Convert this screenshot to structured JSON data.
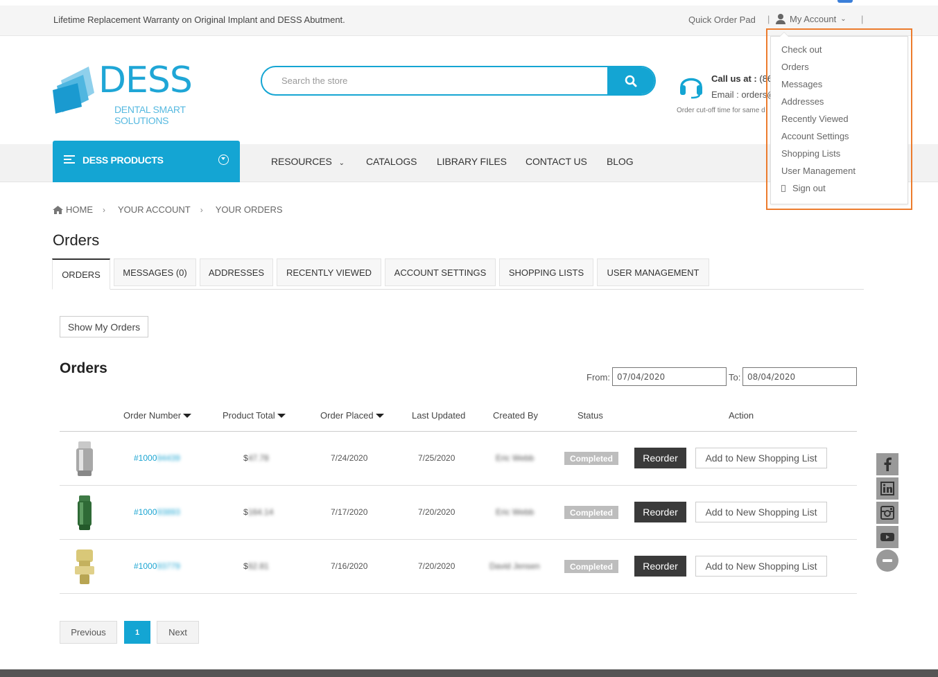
{
  "topbar": {
    "warranty": "Lifetime Replacement Warranty on Original Implant and DESS Abutment.",
    "quick_order": "Quick Order Pad",
    "sep": "|",
    "my_account": "My Account"
  },
  "logo": {
    "name": "DESS",
    "tagline": "DENTAL SMART SOLUTIONS"
  },
  "search": {
    "placeholder": "Search the store"
  },
  "contact": {
    "call_label": "Call us at :",
    "call_value": "(86",
    "email": "Email : orders@",
    "cutoff": "Order cut-off time for same d"
  },
  "nav": {
    "products": "DESS PRODUCTS",
    "items": [
      "RESOURCES",
      "CATALOGS",
      "LIBRARY FILES",
      "CONTACT US",
      "BLOG"
    ]
  },
  "breadcrumb": [
    "HOME",
    "YOUR ACCOUNT",
    "YOUR ORDERS"
  ],
  "page_title": "Orders",
  "tabs": [
    "ORDERS",
    "MESSAGES (0)",
    "ADDRESSES",
    "RECENTLY VIEWED",
    "ACCOUNT SETTINGS",
    "SHOPPING LISTS",
    "USER MANAGEMENT"
  ],
  "show_orders": "Show My Orders",
  "orders_heading": "Orders",
  "date_range": {
    "from_label": "From:",
    "from": "07/04/2020",
    "to_label": "To:",
    "to": "08/04/2020"
  },
  "table": {
    "headers": [
      "Order Number",
      "Product Total",
      "Order Placed",
      "Last Updated",
      "Created By",
      "Status",
      "Action"
    ],
    "rows": [
      {
        "order_prefix": "#1000",
        "order_blur": "94439",
        "total_prefix": "$",
        "total_blur": "47.78",
        "placed": "7/24/2020",
        "updated": "7/25/2020",
        "created_by": "Eric Webb",
        "status": "Completed",
        "reorder": "Reorder",
        "add_list": "Add to New Shopping List"
      },
      {
        "order_prefix": "#1000",
        "order_blur": "93893",
        "total_prefix": "$",
        "total_blur": "164.14",
        "placed": "7/17/2020",
        "updated": "7/20/2020",
        "created_by": "Eric Webb",
        "status": "Completed",
        "reorder": "Reorder",
        "add_list": "Add to New Shopping List"
      },
      {
        "order_prefix": "#1000",
        "order_blur": "93779",
        "total_prefix": "$",
        "total_blur": "62.81",
        "placed": "7/16/2020",
        "updated": "7/20/2020",
        "created_by": "David Jensen",
        "status": "Completed",
        "reorder": "Reorder",
        "add_list": "Add to New Shopping List"
      }
    ]
  },
  "pager": {
    "previous": "Previous",
    "current": "1",
    "next": "Next"
  },
  "dropdown": [
    "Check out",
    "Orders",
    "Messages",
    "Addresses",
    "Recently Viewed",
    "Account Settings",
    "Shopping Lists",
    "User Management",
    "Sign out"
  ],
  "colors": {
    "brand": "#14a5d3",
    "highlight": "#ec7b2c",
    "status": "#bdbdbd"
  },
  "icons": [
    "search-icon",
    "user-icon",
    "headset-icon",
    "menu-icon",
    "home-icon",
    "facebook-icon",
    "linkedin-icon",
    "instagram-icon",
    "youtube-icon",
    "minus-icon"
  ]
}
